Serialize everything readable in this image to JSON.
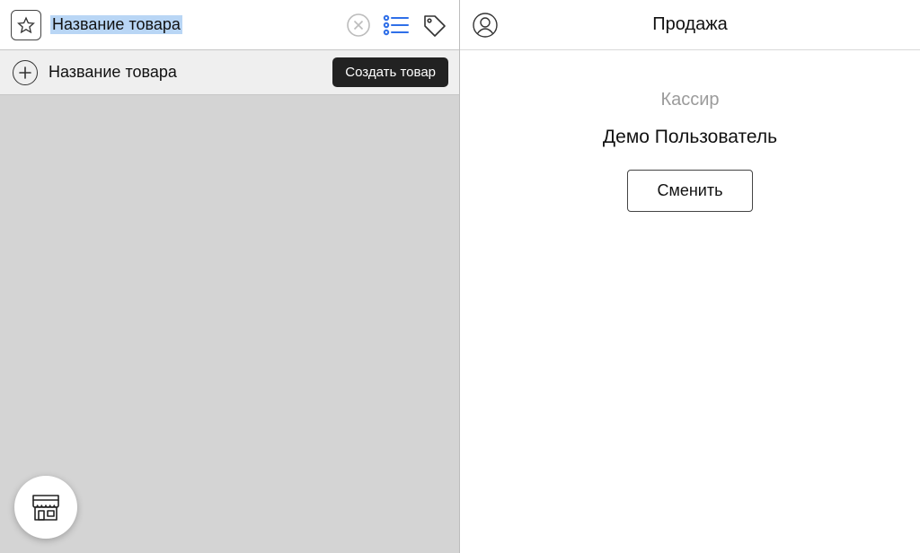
{
  "left": {
    "search_value": "Название товара",
    "row": {
      "item_label": "Название товара",
      "create_button": "Создать товар"
    }
  },
  "right": {
    "title": "Продажа",
    "cashier_label": "Кассир",
    "cashier_name": "Демо Пользователь",
    "change_button": "Сменить"
  },
  "colors": {
    "accent_list": "#2f6fe8",
    "selection_bg": "#b9d6f5",
    "button_dark_bg": "#222222"
  }
}
